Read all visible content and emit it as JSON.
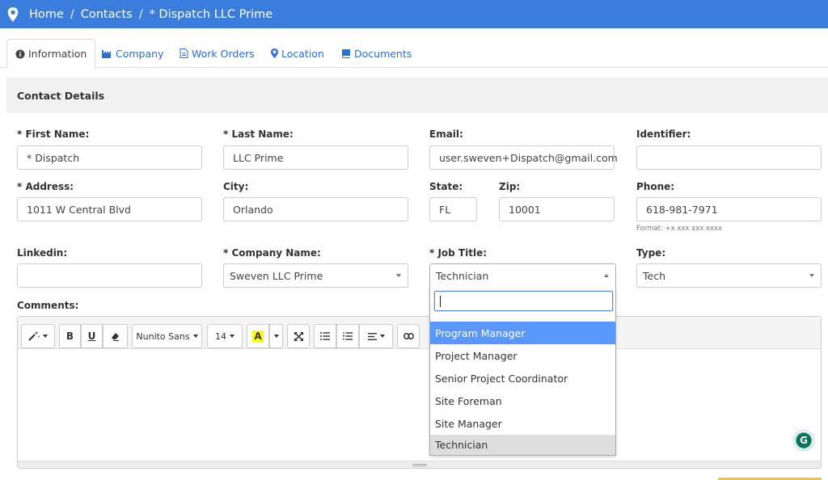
{
  "breadcrumb": {
    "items": [
      "Home",
      "Contacts",
      "* Dispatch LLC Prime"
    ],
    "separator": "/"
  },
  "tabs": [
    {
      "label": "Information",
      "icon": "info-circle-icon",
      "active": true
    },
    {
      "label": "Company",
      "icon": "industry-icon"
    },
    {
      "label": "Work Orders",
      "icon": "file-icon"
    },
    {
      "label": "Location",
      "icon": "map-marker-icon"
    },
    {
      "label": "Documents",
      "icon": "book-icon"
    }
  ],
  "section_title": "Contact Details",
  "fields": {
    "first_name": {
      "label": "* First Name:",
      "value": "* Dispatch"
    },
    "last_name": {
      "label": "* Last Name:",
      "value": "LLC Prime"
    },
    "email": {
      "label": "Email:",
      "value": "user.sweven+Dispatch@gmail.com"
    },
    "identifier": {
      "label": "Identifier:",
      "value": ""
    },
    "address": {
      "label": "* Address:",
      "value": "1011 W Central Blvd"
    },
    "city": {
      "label": "City:",
      "value": "Orlando"
    },
    "state": {
      "label": "State:",
      "value": "FL"
    },
    "zip": {
      "label": "Zip:",
      "value": "10001"
    },
    "phone": {
      "label": "Phone:",
      "value": "618-981-7971",
      "hint": "Format: +x xxx xxx xxxx"
    },
    "linkedin": {
      "label": "Linkedin:",
      "value": ""
    },
    "company_name": {
      "label": "* Company Name:",
      "value": "Sweven LLC Prime"
    },
    "job_title": {
      "label": "* Job Title:",
      "value": "Technician"
    },
    "type": {
      "label": "Type:",
      "value": "Tech"
    },
    "comments": {
      "label": "Comments:"
    }
  },
  "editor_toolbar": {
    "font_name": "Nunito Sans",
    "font_size": "14",
    "buttons": [
      "magic-icon",
      "bold-icon",
      "underline-icon",
      "eraser-icon",
      "font-color-icon",
      "fullscreen-icon",
      "unordered-list-icon",
      "ordered-list-icon",
      "align-icon",
      "link-icon"
    ],
    "bold_label": "B",
    "underline_label": "U",
    "color_label": "A"
  },
  "job_title_dropdown": {
    "search_value": "",
    "options": [
      "Program Manager",
      "Project Manager",
      "Senior Project Coordinator",
      "Site Foreman",
      "Site Manager",
      "Technician"
    ],
    "highlighted": "Program Manager",
    "selected": "Technician"
  },
  "colors": {
    "brand": "#3b7ddd",
    "link": "#2c6fd6",
    "highlight": "#5897fb",
    "grammarly": "#15c39a"
  },
  "grammarly_label": "G"
}
